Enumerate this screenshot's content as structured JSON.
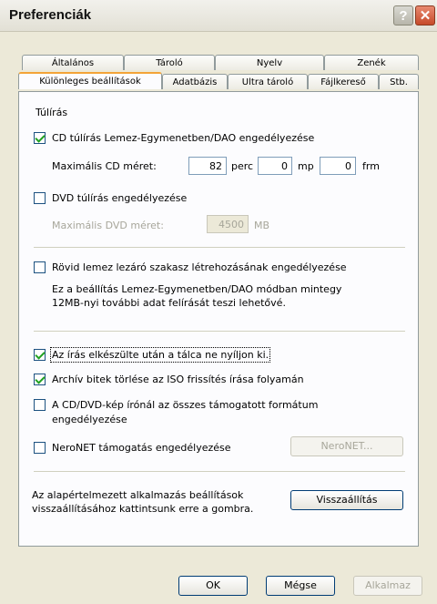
{
  "window": {
    "title": "Preferenciák",
    "help_glyph": "?",
    "close_glyph": "✕"
  },
  "tabs_row1": [
    "Általános",
    "Tároló",
    "Nyelv",
    "Zenék"
  ],
  "tabs_row2": [
    "Különleges beállítások",
    "Adatbázis",
    "Ultra tároló",
    "Fájlkereső",
    "Stb."
  ],
  "panel": {
    "section_title": "Túlírás",
    "cd_overburn": {
      "label": "CD túlírás Lemez-Egymenetben/DAO engedélyezése",
      "checked": true
    },
    "cd_max": {
      "label": "Maximális CD méret:",
      "min_value": "82",
      "min_unit": "perc",
      "sec_value": "0",
      "sec_unit": "mp",
      "frm_value": "0",
      "frm_unit": "frm"
    },
    "dvd_overburn": {
      "label": "DVD túlírás engedélyezése",
      "checked": false
    },
    "dvd_max": {
      "label": "Maximális DVD méret:",
      "value": "4500",
      "unit": "MB"
    },
    "short_leadout": {
      "label": "Rövid lemez lezáró szakasz létrehozásának engedélyezése",
      "checked": false
    },
    "short_leadout_desc_1": "Ez a beállítás Lemez-Egymenetben/DAO módban mintegy",
    "short_leadout_desc_2": "12MB-nyi további adat felírását teszi lehetővé.",
    "no_tray_open": {
      "label": "Az írás elkészülte után a tálca ne nyíljon ki.",
      "checked": true
    },
    "clear_archive": {
      "label": "Archív bitek törlése az ISO frissítés írása folyamán",
      "checked": true
    },
    "image_recorder_line1": "A CD/DVD-kép írónál az összes támogatott formátum",
    "image_recorder_line2": "engedélyezése",
    "image_recorder_checked": false,
    "neronet": {
      "label": "NeroNET támogatás engedélyezése",
      "checked": false,
      "button": "NeroNET..."
    },
    "reset_desc_1": "Az alapértelmezett alkalmazás beállítások",
    "reset_desc_2": "visszaállításához kattintsunk erre a gombra.",
    "reset_button": "Visszaállítás"
  },
  "footer": {
    "ok": "OK",
    "cancel": "Mégse",
    "apply": "Alkalmaz"
  }
}
